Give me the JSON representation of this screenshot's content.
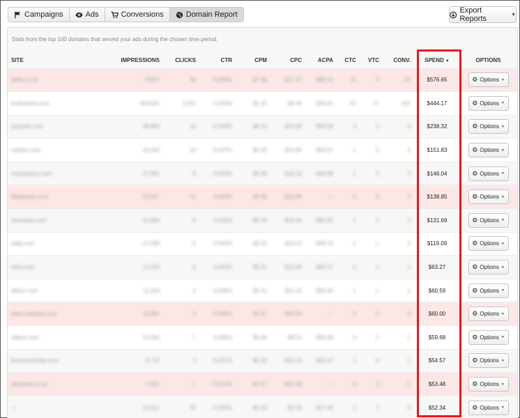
{
  "tabs": [
    {
      "label": "Campaigns",
      "icon": "flag-icon"
    },
    {
      "label": "Ads",
      "icon": "eye-icon"
    },
    {
      "label": "Conversions",
      "icon": "cart-icon"
    },
    {
      "label": "Domain Report",
      "icon": "globe-icon",
      "active": true
    }
  ],
  "export": {
    "label": "Export Reports",
    "icon": "download-icon"
  },
  "panel": {
    "note": "Stats from the top 100 domains that served your ads during the chosen time period."
  },
  "table": {
    "columns": {
      "site": "SITE",
      "impressions": "IMPRESSIONS",
      "clicks": "CLICKS",
      "ctr": "CTR",
      "cpm": "CPM",
      "cpc": "CPC",
      "acpa": "ACPA",
      "ctc": "CTC",
      "vtc": "VTC",
      "conv": "CONV.",
      "spend": "SPEND",
      "options": "OPTIONS"
    },
    "option_label": "Options",
    "rows": [
      {
        "site": "delta.co.uk",
        "impressions": "75007",
        "clicks": "33",
        "ctr": "0.044%",
        "cpm": "$7.68",
        "cpc": "$17.47",
        "acpa": "$96.11",
        "ctc": "11",
        "vtc": "0",
        "conv": "25",
        "spend": "$576.65",
        "highlight": true
      },
      {
        "site": "brokestore.com",
        "impressions": "404,631",
        "clicks": "1,021",
        "ctr": "0.252%",
        "cpm": "$1.10",
        "cpc": "$0.44",
        "acpa": "$29.61",
        "ctc": "41",
        "vtc": "27",
        "conv": "101",
        "spend": "$444.17",
        "highlight": false
      },
      {
        "site": "youtube.com",
        "impressions": "38,884",
        "clicks": "10",
        "ctr": "0.026%",
        "cpm": "$6.13",
        "cpc": "$23.83",
        "acpa": "$59.58",
        "ctc": "3",
        "vtc": "1",
        "conv": "4",
        "spend": "$238.32",
        "highlight": false
      },
      {
        "site": "celebtv.com",
        "impressions": "30,005",
        "clicks": "14",
        "ctr": "0.047%",
        "cpm": "$5.06",
        "cpc": "$10.85",
        "acpa": "$50.61",
        "ctc": "1",
        "vtc": "2",
        "conv": "3",
        "spend": "$151.83",
        "highlight": false
      },
      {
        "site": "moviepress.com",
        "impressions": "27,061",
        "clicks": "9",
        "ctr": "0.033%",
        "cpm": "$5.40",
        "cpc": "$16.23",
        "acpa": "$48.68",
        "ctc": "1",
        "vtc": "2",
        "conv": "3",
        "spend": "$146.04",
        "highlight": false
      },
      {
        "site": "filebazaar.co.in",
        "impressions": "23,407",
        "clicks": "10",
        "ctr": "0.043%",
        "cpm": "$5.93",
        "cpc": "$13.89",
        "acpa": "—",
        "ctc": "0",
        "vtc": "0",
        "conv": "0",
        "spend": "$138.85",
        "highlight": true
      },
      {
        "site": "newsweb.com",
        "impressions": "22,804",
        "clicks": "8",
        "ctr": "0.035%",
        "cpm": "$5.78",
        "cpc": "$16.46",
        "acpa": "$65.85",
        "ctc": "1",
        "vtc": "1",
        "conv": "2",
        "spend": "$131.69",
        "highlight": false
      },
      {
        "site": "daily.com",
        "impressions": "21,590",
        "clicks": "9",
        "ctr": "0.042%",
        "cpm": "$5.52",
        "cpc": "$13.23",
        "acpa": "$39.70",
        "ctc": "2",
        "vtc": "1",
        "conv": "3",
        "spend": "$119.09",
        "highlight": false
      },
      {
        "site": "tvlist.com",
        "impressions": "11,915",
        "clicks": "5",
        "ctr": "0.042%",
        "cpm": "$5.31",
        "cpc": "$12.65",
        "acpa": "$63.27",
        "ctc": "0",
        "vtc": "1",
        "conv": "1",
        "spend": "$63.27",
        "highlight": false
      },
      {
        "site": "albion.com",
        "impressions": "11,203",
        "clicks": "4",
        "ctr": "0.036%",
        "cpm": "$5.41",
        "cpc": "$15.15",
        "acpa": "$30.30",
        "ctc": "1",
        "vtc": "1",
        "conv": "2",
        "spend": "$60.59",
        "highlight": false
      },
      {
        "site": "www.stateline.com",
        "impressions": "10,881",
        "clicks": "3",
        "ctr": "0.028%",
        "cpm": "$5.51",
        "cpc": "$20.00",
        "acpa": "—",
        "ctc": "0",
        "vtc": "0",
        "conv": "0",
        "spend": "$60.00",
        "highlight": true
      },
      {
        "site": "dabuz.com",
        "impressions": "10,550",
        "clicks": "7",
        "ctr": "0.066%",
        "cpm": "$5.66",
        "cpc": "$8.53",
        "acpa": "$59.68",
        "ctc": "0",
        "vtc": "1",
        "conv": "1",
        "spend": "$59.68",
        "highlight": false
      },
      {
        "site": "businesstoday.com",
        "impressions": "9,712",
        "clicks": "3",
        "ctr": "0.031%",
        "cpm": "$5.62",
        "cpc": "$18.19",
        "acpa": "$54.57",
        "ctc": "1",
        "vtc": "0",
        "conv": "1",
        "spend": "$54.57",
        "highlight": false
      },
      {
        "site": "dailymail.co.uk",
        "impressions": "7,061",
        "clicks": "1",
        "ctr": "0.014%",
        "cpm": "$7.57",
        "cpc": "$53.48",
        "acpa": "—",
        "ctc": "0",
        "vtc": "0",
        "conv": "0",
        "spend": "$53.48",
        "highlight": true
      },
      {
        "site": "—",
        "impressions": "10,012",
        "clicks": "25",
        "ctr": "0.250%",
        "cpm": "$5.23",
        "cpc": "$2.09",
        "acpa": "$17.45",
        "ctc": "1",
        "vtc": "2",
        "conv": "3",
        "spend": "$52.34",
        "highlight": false
      }
    ]
  }
}
